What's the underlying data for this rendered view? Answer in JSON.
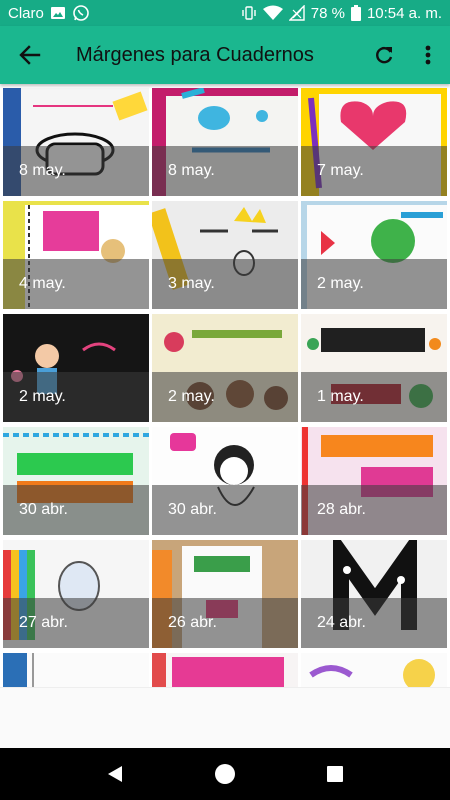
{
  "status_bar": {
    "carrier": "Claro",
    "battery": "78 %",
    "time": "10:54 a. m."
  },
  "app_bar": {
    "title": "Márgenes para Cuadernos"
  },
  "videos": [
    {
      "date": "8 may."
    },
    {
      "date": "8 may."
    },
    {
      "date": "7 may."
    },
    {
      "date": "4 may."
    },
    {
      "date": "3 may."
    },
    {
      "date": "2 may."
    },
    {
      "date": "2 may."
    },
    {
      "date": "2 may."
    },
    {
      "date": "1 may."
    },
    {
      "date": "30 abr."
    },
    {
      "date": "30 abr."
    },
    {
      "date": "28 abr."
    },
    {
      "date": "27 abr."
    },
    {
      "date": "26 abr."
    },
    {
      "date": "24 abr."
    },
    {
      "date": ""
    },
    {
      "date": ""
    },
    {
      "date": ""
    }
  ],
  "colors": {
    "app_bar": "#1bb78f",
    "status_bar": "#17ab86"
  }
}
